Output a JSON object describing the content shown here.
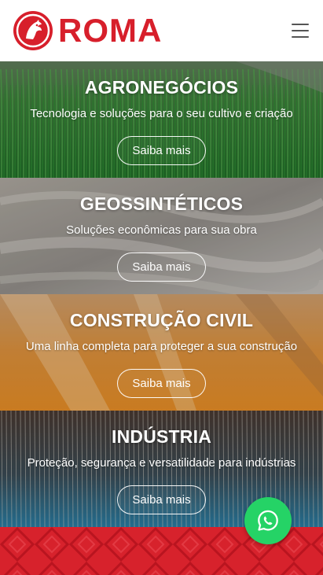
{
  "brand": {
    "name": "ROMA",
    "color": "#d71f2b"
  },
  "header": {
    "menu_icon": "hamburger-menu-icon"
  },
  "sections": [
    {
      "title": "AGRONEGÓCIOS",
      "subtitle": "Tecnologia e soluções para o seu cultivo e criação",
      "button": "Saiba mais"
    },
    {
      "title": "GEOSSINTÉTICOS",
      "subtitle": "Soluções econômicas para sua obra",
      "button": "Saiba mais"
    },
    {
      "title": "CONSTRUÇÃO CIVIL",
      "subtitle": "Uma linha completa para proteger a sua construção",
      "button": "Saiba mais"
    },
    {
      "title": "INDÚSTRIA",
      "subtitle": "Proteção, segurança e versatilidade para indústrias",
      "button": "Saiba mais"
    }
  ],
  "floating": {
    "icon": "whatsapp-icon",
    "color": "#25d366"
  },
  "footer": {
    "color": "#d7222c"
  }
}
